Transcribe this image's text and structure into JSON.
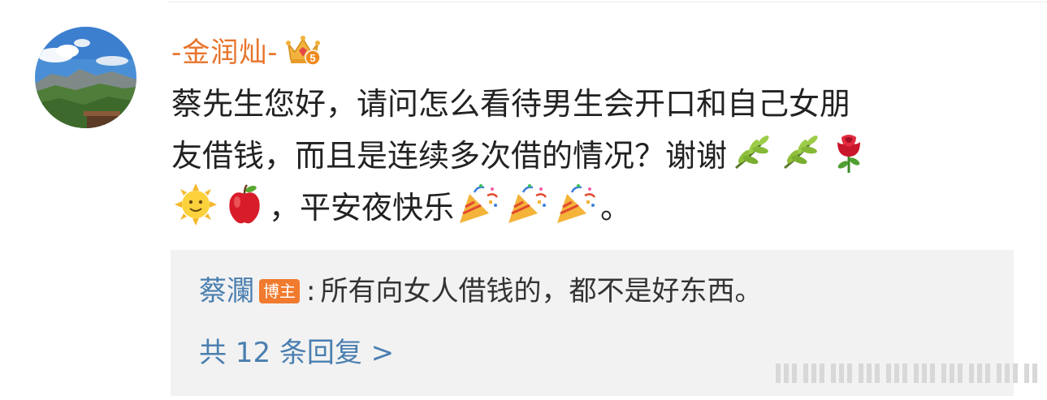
{
  "comment": {
    "username": "-金润灿-",
    "line1": "蔡先生您好，请问怎么看待男生会开口和自己女朋",
    "line2": "友借钱，而且是连续多次借的情况？谢谢",
    "line3a": "，平安夜快乐",
    "line3b": "。",
    "level_badge": "5",
    "emojis": [
      "olive-branch",
      "olive-branch",
      "rose",
      "sun-with-face",
      "red-apple",
      "party-popper",
      "party-popper",
      "party-popper"
    ]
  },
  "reply": {
    "author": "蔡瀾",
    "badge": "博主",
    "separator": ":",
    "text": "所有向女人借钱的，都不是好东西。"
  },
  "reply_count": "共 12 条回复 >",
  "colors": {
    "username": "#e8742c",
    "link": "#4a7fb0",
    "badge": "#f07a2e",
    "reply_bg": "#f2f2f2",
    "text": "#222222"
  }
}
